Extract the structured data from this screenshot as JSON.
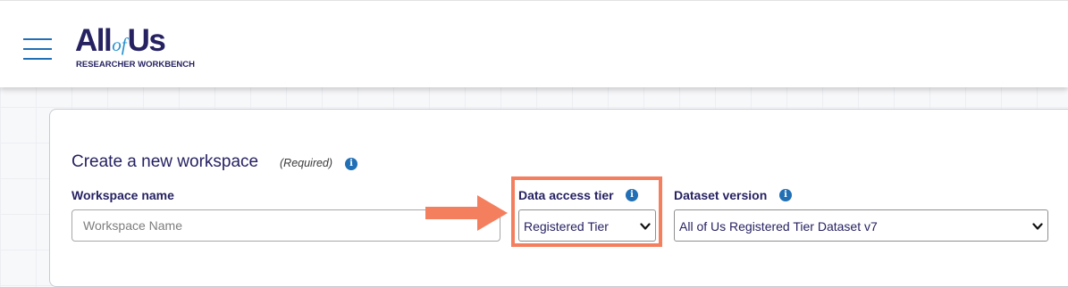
{
  "header": {
    "logo": {
      "main_left": "All",
      "main_of": "of",
      "main_right": "Us",
      "subtitle": "RESEARCHER WORKBENCH"
    }
  },
  "form": {
    "title": "Create a new workspace",
    "required_note": "(Required)",
    "workspace_name": {
      "label": "Workspace name",
      "value": "",
      "placeholder": "Workspace Name"
    },
    "data_access_tier": {
      "label": "Data access tier",
      "selected": "Registered Tier"
    },
    "dataset_version": {
      "label": "Dataset version",
      "selected": "All of Us Registered Tier Dataset v7"
    }
  },
  "icons": {
    "menu": "hamburger-menu-icon",
    "info": "info-icon",
    "chevron": "chevron-down-icon",
    "annotation": "arrow-right-icon"
  },
  "colors": {
    "brand_navy": "#262262",
    "brand_blue": "#216fb4",
    "annotation": "#f47f5f"
  }
}
